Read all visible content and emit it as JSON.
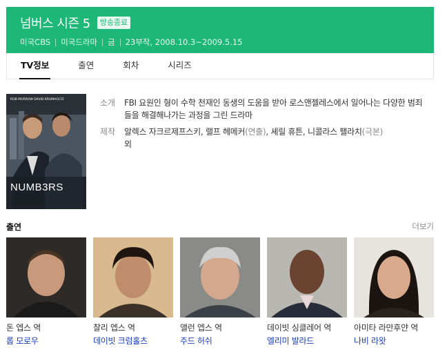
{
  "header": {
    "title": "넘버스 시즌 5",
    "badge": "방송종료",
    "meta": [
      "미국CBS",
      "미국드라마",
      "금",
      "23부작, 2008.10.3~2009.5.15"
    ]
  },
  "tabs": [
    {
      "label": "TV정보",
      "active": true
    },
    {
      "label": "출연",
      "active": false
    },
    {
      "label": "회차",
      "active": false
    },
    {
      "label": "시리즈",
      "active": false
    }
  ],
  "poster": {
    "top_names": "ROB MORROW  DAVID KRUMHOLTZ",
    "logo_text": "NUMB3RS"
  },
  "info": {
    "intro_label": "소개",
    "intro_text": "FBI 요원인 형이 수학 천재인 동생의 도움을 받아 로스앤젤레스에서 일어나는 다양한 범죄들을 해결해나가는 과정을 그린 드라마",
    "production_label": "제작",
    "production_names": "알렉스 자크르제프스키, 랠프 헤메커",
    "production_role": "(연출)",
    "production_more": ", 셰릴 휴튼, 니콜라스 팰라치",
    "production_role2": "(극본)",
    "production_etc": "외"
  },
  "cast": {
    "title": "출연",
    "more": "더보기",
    "members": [
      {
        "role": "돈 엡스 역",
        "actor": "롭 모로우"
      },
      {
        "role": "찰리 엡스 역",
        "actor": "데이빗 크럼홀츠"
      },
      {
        "role": "앨런 엡스 역",
        "actor": "주드 허쉬"
      },
      {
        "role": "데이빗 싱클레어 역",
        "actor": "엘리미 발라드"
      },
      {
        "role": "아미타 라만후얀 역",
        "actor": "나비 라왓"
      }
    ]
  },
  "colors": {
    "header_bg": "#1db877",
    "link": "#1a3fb8"
  }
}
